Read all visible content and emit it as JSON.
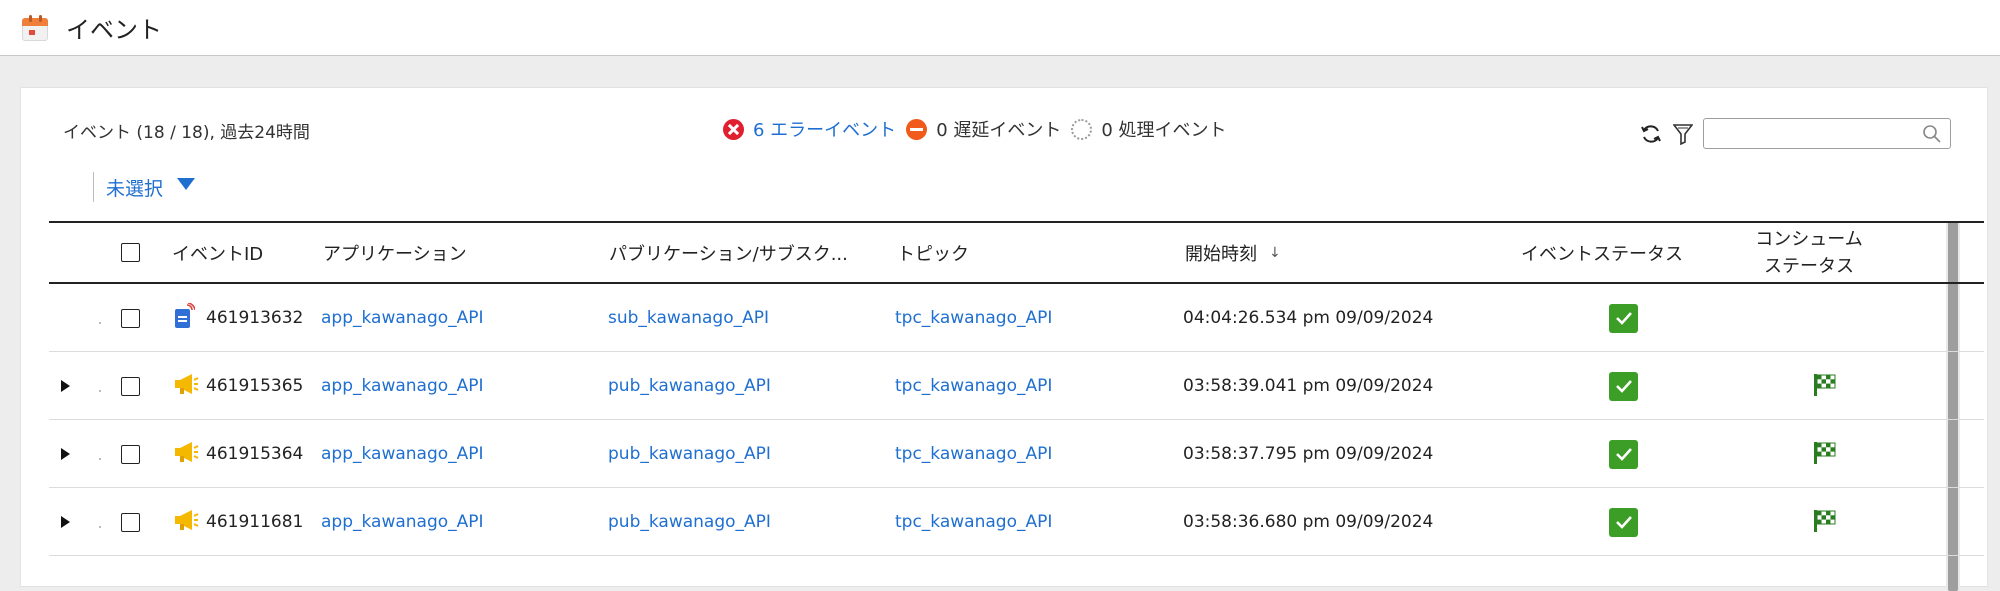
{
  "header": {
    "title": "イベント",
    "icon": "calendar-icon"
  },
  "summary": "イベント (18 / 18), 過去24時間",
  "counters": [
    {
      "label": "6 エラーイベント",
      "kind": "error",
      "color": "#e0202f"
    },
    {
      "label": "0 遅延イベント",
      "kind": "late",
      "color": "#f05a1a"
    },
    {
      "label": "0 処理イベント",
      "kind": "processing",
      "color": "#9a9a9a"
    }
  ],
  "toolbar": {
    "refresh_icon": "refresh-icon",
    "filter_icon": "filter-icon",
    "search_value": "",
    "search_icon": "search-icon"
  },
  "selector": {
    "label": "未選択"
  },
  "columns": {
    "event_id": "イベントID",
    "application": "アプリケーション",
    "pubsub": "パブリケーション/サブスク...",
    "topic": "トピック",
    "start_time": "開始時刻",
    "event_status": "イベントステータス",
    "consume_status": "コンシューム ステータス"
  },
  "rows": [
    {
      "expandable": false,
      "type_icon": "subscription-document-icon",
      "event_id": "461913632",
      "application": "app_kawanago_API",
      "pubsub": "sub_kawanago_API",
      "topic": "tpc_kawanago_API",
      "start_time": "04:04:26.534 pm 09/09/2024",
      "event_status": "success",
      "consume_status": ""
    },
    {
      "expandable": true,
      "type_icon": "megaphone-icon",
      "event_id": "461915365",
      "application": "app_kawanago_API",
      "pubsub": "pub_kawanago_API",
      "topic": "tpc_kawanago_API",
      "start_time": "03:58:39.041 pm 09/09/2024",
      "event_status": "success",
      "consume_status": "finished"
    },
    {
      "expandable": true,
      "type_icon": "megaphone-icon",
      "event_id": "461915364",
      "application": "app_kawanago_API",
      "pubsub": "pub_kawanago_API",
      "topic": "tpc_kawanago_API",
      "start_time": "03:58:37.795 pm 09/09/2024",
      "event_status": "success",
      "consume_status": "finished"
    },
    {
      "expandable": true,
      "type_icon": "megaphone-icon",
      "event_id": "461911681",
      "application": "app_kawanago_API",
      "pubsub": "pub_kawanago_API",
      "topic": "tpc_kawanago_API",
      "start_time": "03:58:36.680 pm 09/09/2024",
      "event_status": "success",
      "consume_status": "finished"
    }
  ],
  "colors": {
    "accent": "#1f6fd1",
    "success": "#3c9d27",
    "warning": "#f5b800"
  }
}
